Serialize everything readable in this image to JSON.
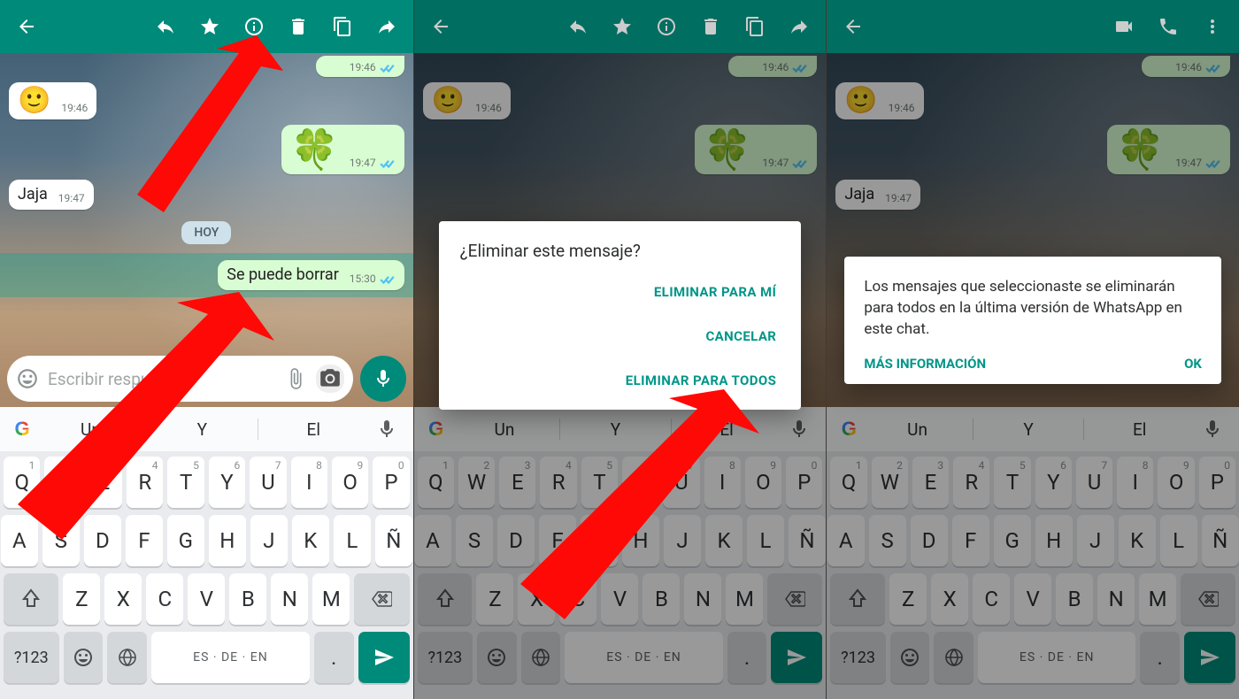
{
  "colors": {
    "teal": "#008a79",
    "accent": "#00a884"
  },
  "toolbar_selection": {
    "icons": [
      "back",
      "reply",
      "star",
      "info",
      "delete",
      "copy",
      "forward"
    ]
  },
  "toolbar_chat": {
    "icons": [
      "back",
      "video",
      "phone",
      "more"
    ]
  },
  "messages": [
    {
      "side": "out",
      "type": "text_trail",
      "text": "",
      "time": "19:46",
      "read": true
    },
    {
      "side": "in",
      "type": "emoji",
      "emoji": "🙂",
      "time": "19:46"
    },
    {
      "side": "out",
      "type": "emoji",
      "emoji": "🍀",
      "time": "19:47",
      "read": true
    },
    {
      "side": "in",
      "type": "text",
      "text": "Jaja",
      "time": "19:47"
    }
  ],
  "date_chip": "HOY",
  "selected_message": {
    "text": "Se puede borrar",
    "time": "15:30",
    "read": true
  },
  "composer": {
    "placeholder": "Escribir respuesta..."
  },
  "suggestions": [
    "Un",
    "Y",
    "El"
  ],
  "keyboard": {
    "row1": [
      {
        "k": "Q",
        "s": "1"
      },
      {
        "k": "W",
        "s": "2"
      },
      {
        "k": "E",
        "s": "3"
      },
      {
        "k": "R",
        "s": "4"
      },
      {
        "k": "T",
        "s": "5"
      },
      {
        "k": "Y",
        "s": "6"
      },
      {
        "k": "U",
        "s": "7"
      },
      {
        "k": "I",
        "s": "8"
      },
      {
        "k": "O",
        "s": "9"
      },
      {
        "k": "P",
        "s": "0"
      }
    ],
    "row2": [
      "A",
      "S",
      "D",
      "F",
      "G",
      "H",
      "J",
      "K",
      "L",
      "Ñ"
    ],
    "row3": [
      "Z",
      "X",
      "C",
      "V",
      "B",
      "N",
      "M"
    ],
    "sym_label": "?123",
    "space_label": "ES · DE · EN"
  },
  "delete_dialog": {
    "title": "¿Eliminar este mensaje?",
    "opt_me": "ELIMINAR PARA MÍ",
    "opt_cancel": "CANCELAR",
    "opt_all": "ELIMINAR PARA TODOS"
  },
  "info_dialog": {
    "body": "Los mensajes que seleccionaste se eliminarán para todos en la última versión de WhatsApp en este chat.",
    "more": "MÁS INFORMACIÓN",
    "ok": "OK"
  }
}
